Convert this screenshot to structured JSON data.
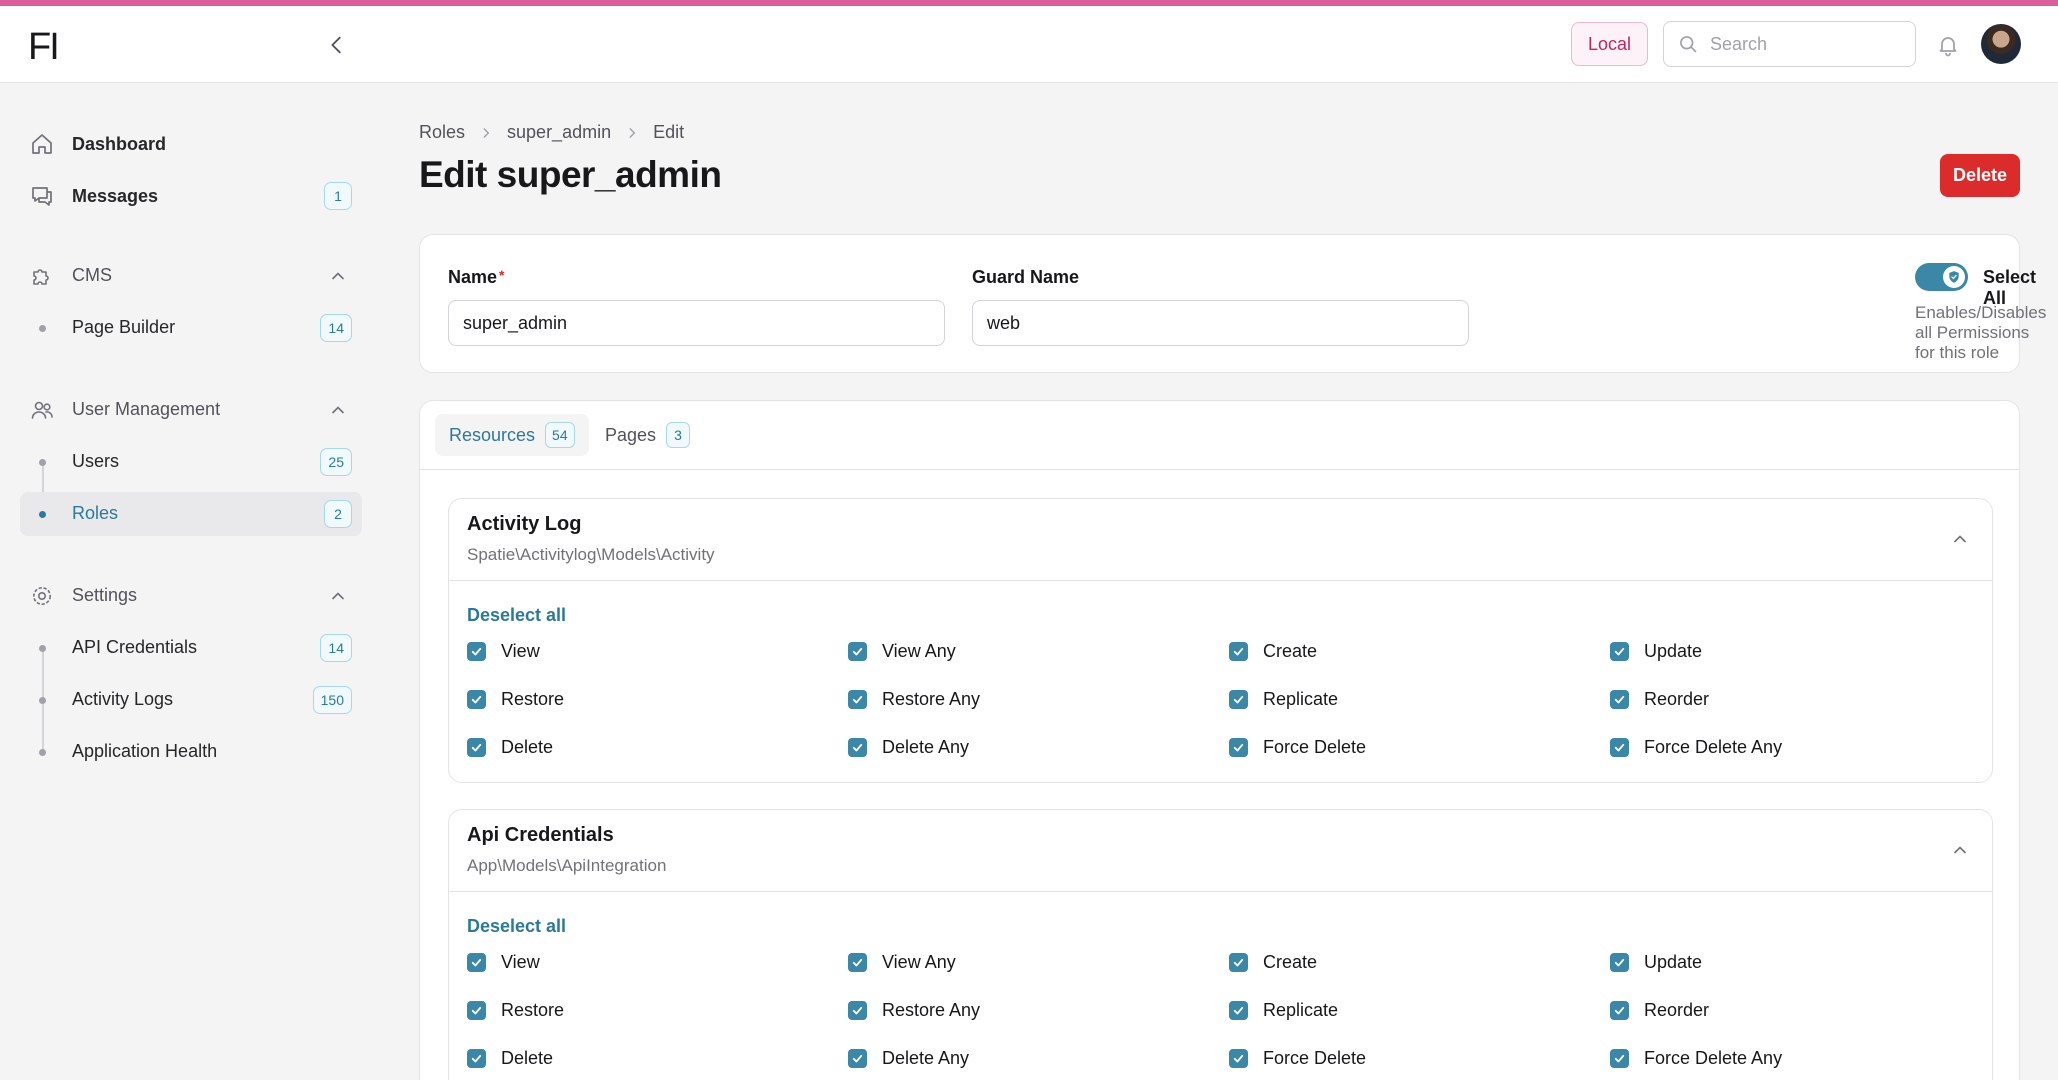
{
  "colors": {
    "accent": "#3a87a8",
    "brand_bar": "#db5f9a",
    "danger": "#dc2b2b"
  },
  "topbar": {
    "logo": "FI",
    "environment_badge": "Local",
    "search_placeholder": "Search",
    "icons": [
      "chevron-left-icon",
      "search-icon",
      "bell-icon"
    ]
  },
  "sidebar": {
    "dashboard": {
      "label": "Dashboard",
      "icon": "home-icon"
    },
    "messages": {
      "label": "Messages",
      "badge": "1",
      "icon": "chat-icon"
    },
    "groups": [
      {
        "label": "CMS",
        "icon": "puzzle-icon",
        "items": [
          {
            "label": "Page Builder",
            "badge": "14"
          }
        ]
      },
      {
        "label": "User Management",
        "icon": "users-icon",
        "items": [
          {
            "label": "Users",
            "badge": "25"
          },
          {
            "label": "Roles",
            "badge": "2",
            "active": true
          }
        ]
      },
      {
        "label": "Settings",
        "icon": "gear-icon",
        "items": [
          {
            "label": "API Credentials",
            "badge": "14"
          },
          {
            "label": "Activity Logs",
            "badge": "150"
          },
          {
            "label": "Application Health",
            "badge": ""
          }
        ]
      }
    ]
  },
  "breadcrumb": [
    "Roles",
    "super_admin",
    "Edit"
  ],
  "page": {
    "title": "Edit super_admin",
    "delete_label": "Delete"
  },
  "form": {
    "name_label": "Name",
    "name_required_mark": "*",
    "name_value": "super_admin",
    "guard_label": "Guard Name",
    "guard_value": "web",
    "select_all_label": "Select All",
    "select_all_help": "Enables/Disables all Permissions for this role",
    "select_all_on": true
  },
  "tabs": [
    {
      "label": "Resources",
      "badge": "54",
      "active": true
    },
    {
      "label": "Pages",
      "badge": "3",
      "active": false
    }
  ],
  "sections": [
    {
      "title": "Activity Log",
      "subtitle": "Spatie\\Activitylog\\Models\\Activity",
      "deselect_label": "Deselect all",
      "permissions": [
        "View",
        "View Any",
        "Create",
        "Update",
        "Restore",
        "Restore Any",
        "Replicate",
        "Reorder",
        "Delete",
        "Delete Any",
        "Force Delete",
        "Force Delete Any"
      ]
    },
    {
      "title": "Api Credentials",
      "subtitle": "App\\Models\\ApiIntegration",
      "deselect_label": "Deselect all",
      "permissions": [
        "View",
        "View Any",
        "Create",
        "Update",
        "Restore",
        "Restore Any",
        "Replicate",
        "Reorder",
        "Delete",
        "Delete Any",
        "Force Delete",
        "Force Delete Any"
      ]
    }
  ]
}
